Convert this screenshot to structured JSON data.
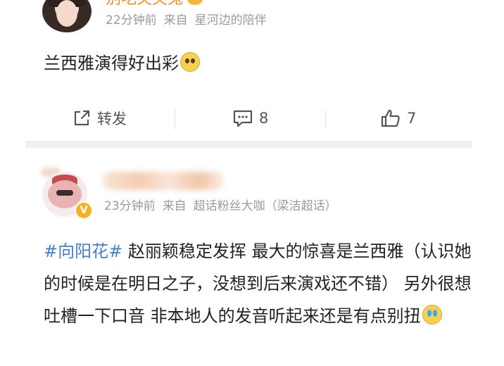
{
  "post1": {
    "username": "别吃芙芙兔",
    "time": "22分钟前",
    "source_prefix": "来自",
    "source": "星河边的陪伴",
    "text": "兰西雅演得好出彩",
    "emoji": "pleading-face"
  },
  "actions": {
    "repost_label": "转发",
    "comment_count": "8",
    "like_count": "7"
  },
  "post2": {
    "time": "23分钟前",
    "source_prefix": "来自",
    "source": "超话粉丝大咖（梁洁超话）",
    "topic": "#向阳花#",
    "text": " 赵丽颖稳定发挥 最大的惊喜是兰西雅（认识她的时候是在明日之子，没想到后来演戏还不错） 另外很想吐槽一下口音 非本地人的发音听起来还是有点别扭",
    "emoji": "laughing-crying-face",
    "verified_mark": "V"
  },
  "colors": {
    "username": "#f08a2a",
    "meta": "#9a9a9a",
    "topic_link": "#4a7fc1",
    "verified": "#f5b324",
    "separator": "#f0f0f0"
  }
}
